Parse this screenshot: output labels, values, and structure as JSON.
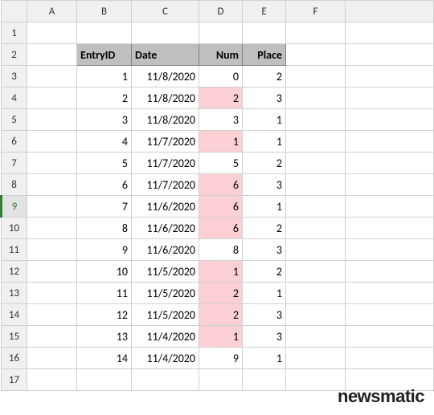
{
  "columns": [
    "A",
    "B",
    "C",
    "D",
    "E",
    "F"
  ],
  "row_headers": [
    1,
    2,
    3,
    4,
    5,
    6,
    7,
    8,
    9,
    10,
    11,
    12,
    13,
    14,
    15,
    16,
    17
  ],
  "selected_row": 9,
  "headers": {
    "entry_id": "EntryID",
    "date": "Date",
    "num": "Num",
    "place": "Place"
  },
  "rows": [
    {
      "entry_id": 1,
      "date": "11/8/2020",
      "num": 0,
      "place": 2,
      "hl": false
    },
    {
      "entry_id": 2,
      "date": "11/8/2020",
      "num": 2,
      "place": 3,
      "hl": true
    },
    {
      "entry_id": 3,
      "date": "11/8/2020",
      "num": 3,
      "place": 1,
      "hl": false
    },
    {
      "entry_id": 4,
      "date": "11/7/2020",
      "num": 1,
      "place": 1,
      "hl": true
    },
    {
      "entry_id": 5,
      "date": "11/7/2020",
      "num": 5,
      "place": 2,
      "hl": false
    },
    {
      "entry_id": 6,
      "date": "11/7/2020",
      "num": 6,
      "place": 3,
      "hl": true
    },
    {
      "entry_id": 7,
      "date": "11/6/2020",
      "num": 6,
      "place": 1,
      "hl": true
    },
    {
      "entry_id": 8,
      "date": "11/6/2020",
      "num": 6,
      "place": 2,
      "hl": true
    },
    {
      "entry_id": 9,
      "date": "11/6/2020",
      "num": 8,
      "place": 3,
      "hl": false
    },
    {
      "entry_id": 10,
      "date": "11/5/2020",
      "num": 1,
      "place": 2,
      "hl": true
    },
    {
      "entry_id": 11,
      "date": "11/5/2020",
      "num": 2,
      "place": 1,
      "hl": true
    },
    {
      "entry_id": 12,
      "date": "11/5/2020",
      "num": 2,
      "place": 3,
      "hl": true
    },
    {
      "entry_id": 13,
      "date": "11/4/2020",
      "num": 1,
      "place": 3,
      "hl": true
    },
    {
      "entry_id": 14,
      "date": "11/4/2020",
      "num": 9,
      "place": 1,
      "hl": false
    }
  ],
  "watermark": "newsmatic"
}
